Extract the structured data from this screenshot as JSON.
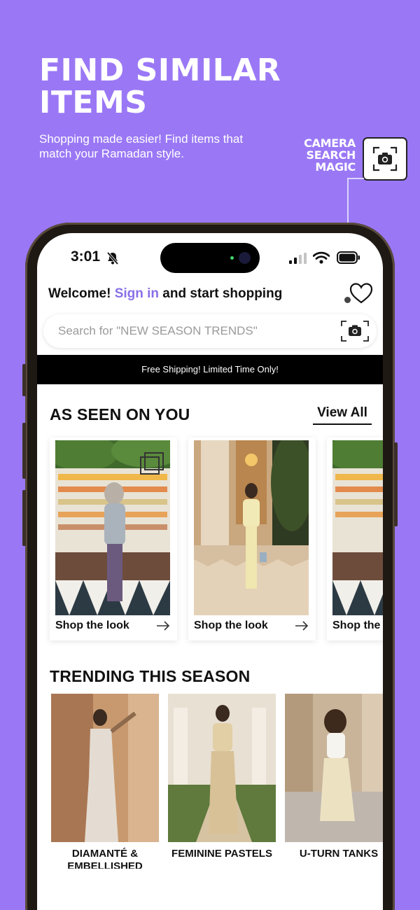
{
  "promo": {
    "title": "FIND SIMILAR ITEMS",
    "subtitle": "Shopping made easier! Find items that match your Ramadan style.",
    "callout": "CAMERA SEARCH MAGIC"
  },
  "status_bar": {
    "time": "3:01",
    "icons": [
      "bell-muted-icon",
      "cellular-signal-icon",
      "wifi-icon",
      "battery-icon"
    ]
  },
  "header": {
    "welcome_prefix": "Welcome!",
    "sign_in": "Sign in",
    "welcome_suffix": "and start shopping"
  },
  "search": {
    "placeholder": "Search for  \"NEW SEASON TRENDS\""
  },
  "banner": {
    "text": "Free Shipping! Limited Time Only!"
  },
  "as_seen_on_you": {
    "title": "AS SEEN ON YOU",
    "view_all": "View All",
    "cards": [
      {
        "label": "Shop the look"
      },
      {
        "label": "Shop the look"
      },
      {
        "label": "Shop the lo"
      }
    ]
  },
  "trending": {
    "title": "TRENDING THIS SEASON",
    "items": [
      {
        "label": "DIAMANTÉ & EMBELLISHED"
      },
      {
        "label": "FEMININE PASTELS"
      },
      {
        "label": "U-TURN TANKS"
      }
    ]
  },
  "colors": {
    "background": "#9a78f5",
    "accent": "#8a70e8",
    "banner": "#000000"
  }
}
